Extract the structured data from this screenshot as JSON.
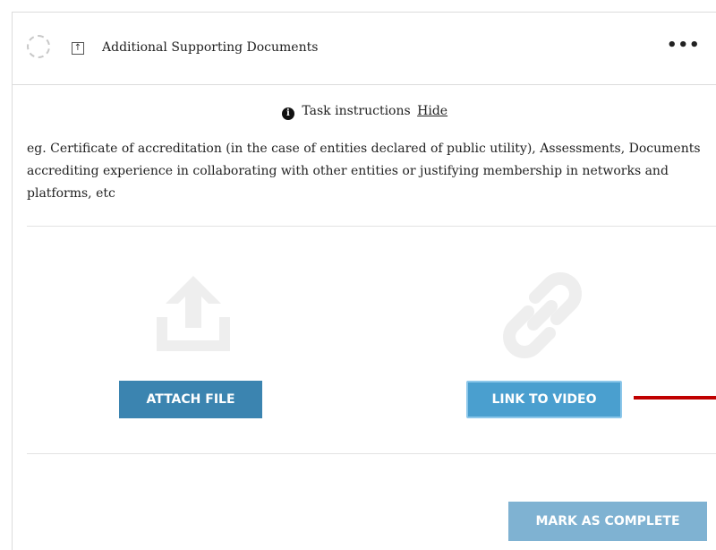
{
  "header": {
    "title": "Additional Supporting Documents",
    "more_label": "•••",
    "upload_glyph": "↑"
  },
  "instructions": {
    "icon_glyph": "i",
    "label": "Task instructions",
    "hide_label": "Hide"
  },
  "description": "eg. Certificate of accreditation (in the case of entities declared of public utility), Assessments, Documents accrediting experience in collaborating with other entities or justifying membership in networks and platforms, etc",
  "actions": {
    "attach_file": "ATTACH FILE",
    "link_to_video": "LINK TO VIDEO",
    "mark_complete": "MARK AS COMPLETE"
  },
  "icons": {
    "status": "dashed-circle-icon",
    "upload_mini": "upload-box-icon",
    "info": "info-icon",
    "upload_large": "upload-tray-icon",
    "link_large": "chain-link-icon"
  },
  "colors": {
    "attach_button": "#3b84b0",
    "link_button": "#4a9fcf",
    "complete_button": "#7fb2d2",
    "arrow": "#c00000",
    "icon_gray": "#eeeeee"
  }
}
